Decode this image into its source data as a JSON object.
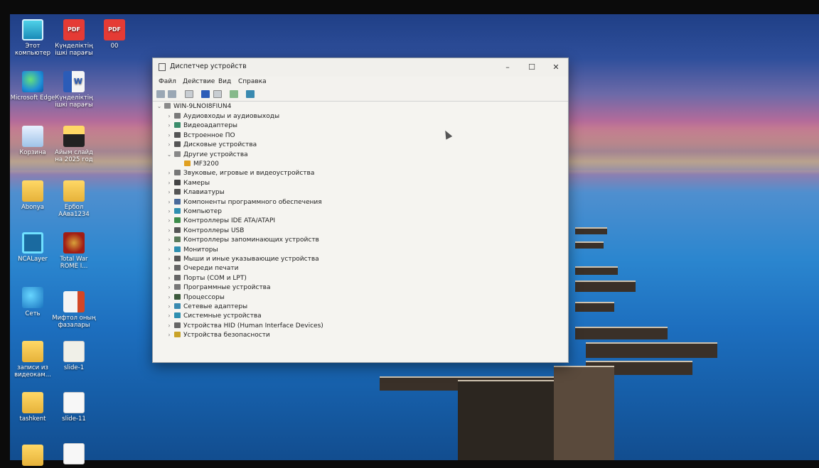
{
  "desktop": {
    "icons": [
      {
        "label": "Этот компьютер",
        "icon": "this-pc-icon"
      },
      {
        "label": "Күнделіктің ішкі парағы",
        "icon": "pdf-file-icon",
        "badge": "PDF"
      },
      {
        "label": "00",
        "icon": "pdf-file-icon",
        "badge": "PDF"
      },
      {
        "label": "Microsoft Edge",
        "icon": "edge-icon"
      },
      {
        "label": "Күнделіктің ішкі парағы",
        "icon": "word-file-icon",
        "badge": "W"
      },
      {
        "label": "Корзина",
        "icon": "recycle-bin-icon"
      },
      {
        "label": "Айым слайд на 2025 год",
        "icon": "folder-icon"
      },
      {
        "label": "Abonya",
        "icon": "folder-icon"
      },
      {
        "label": "Ербол ААва1234",
        "icon": "folder-icon"
      },
      {
        "label": "NCALayer",
        "icon": "ncalayer-icon"
      },
      {
        "label": "Total War ROME I...",
        "icon": "game-icon"
      },
      {
        "label": "Сеть",
        "icon": "network-icon"
      },
      {
        "label": "Мифтол оның фазалары",
        "icon": "powerpoint-file-icon"
      },
      {
        "label": "записи из видеокам...",
        "icon": "folder-icon"
      },
      {
        "label": "slide-1",
        "icon": "image-file-icon"
      },
      {
        "label": "tashkent",
        "icon": "folder-icon"
      },
      {
        "label": "slide-11",
        "icon": "document-file-icon"
      }
    ]
  },
  "window": {
    "title": "Диспетчер устройств",
    "controls": {
      "minimize": "–",
      "maximize": "☐",
      "close": "✕"
    },
    "menu": [
      "Файл",
      "Действие",
      "Вид",
      "Справка"
    ],
    "toolbar": [
      "back-icon",
      "forward-icon",
      "properties-icon",
      "help-icon",
      "view-icon",
      "update-driver-icon",
      "scan-hardware-icon"
    ],
    "tree": {
      "root": "WIN-9LNOI8FIUN4",
      "categories": [
        {
          "label": "Аудиовходы и аудиовыходы",
          "icon": "audio-icon",
          "color": "#7a7a7a"
        },
        {
          "label": "Видеоадаптеры",
          "icon": "display-adapter-icon",
          "color": "#3a8c6a"
        },
        {
          "label": "Встроенное ПО",
          "icon": "firmware-icon",
          "color": "#555555"
        },
        {
          "label": "Дисковые устройства",
          "icon": "disk-icon",
          "color": "#555555"
        },
        {
          "label": "Другие устройства",
          "icon": "unknown-device-icon",
          "color": "#888888",
          "expanded": true,
          "children": [
            {
              "label": "MF3200",
              "icon": "warning-icon"
            }
          ]
        },
        {
          "label": "Звуковые, игровые и видеоустройства",
          "icon": "sound-icon",
          "color": "#777777"
        },
        {
          "label": "Камеры",
          "icon": "camera-icon",
          "color": "#444444"
        },
        {
          "label": "Клавиатуры",
          "icon": "keyboard-icon",
          "color": "#555555"
        },
        {
          "label": "Компоненты программного обеспечения",
          "icon": "software-component-icon",
          "color": "#4a6a9a"
        },
        {
          "label": "Компьютер",
          "icon": "computer-icon",
          "color": "#2e8fb0"
        },
        {
          "label": "Контроллеры IDE ATA/ATAPI",
          "icon": "ide-icon",
          "color": "#3c8c4a"
        },
        {
          "label": "Контроллеры USB",
          "icon": "usb-icon",
          "color": "#555555"
        },
        {
          "label": "Контроллеры запоминающих устройств",
          "icon": "storage-controller-icon",
          "color": "#5a7a5a"
        },
        {
          "label": "Мониторы",
          "icon": "monitor-icon",
          "color": "#2e8fb0"
        },
        {
          "label": "Мыши и иные указывающие устройства",
          "icon": "mouse-icon",
          "color": "#555555"
        },
        {
          "label": "Очереди печати",
          "icon": "print-queue-icon",
          "color": "#666666"
        },
        {
          "label": "Порты (COM и LPT)",
          "icon": "port-icon",
          "color": "#666666"
        },
        {
          "label": "Программные устройства",
          "icon": "software-device-icon",
          "color": "#777777"
        },
        {
          "label": "Процессоры",
          "icon": "processor-icon",
          "color": "#3c5a3c"
        },
        {
          "label": "Сетевые адаптеры",
          "icon": "network-adapter-icon",
          "color": "#3a8ab0"
        },
        {
          "label": "Системные устройства",
          "icon": "system-device-icon",
          "color": "#2e8fb0"
        },
        {
          "label": "Устройства HID (Human Interface Devices)",
          "icon": "hid-icon",
          "color": "#666666"
        },
        {
          "label": "Устройства безопасности",
          "icon": "security-device-icon",
          "color": "#c9a227"
        }
      ]
    }
  }
}
